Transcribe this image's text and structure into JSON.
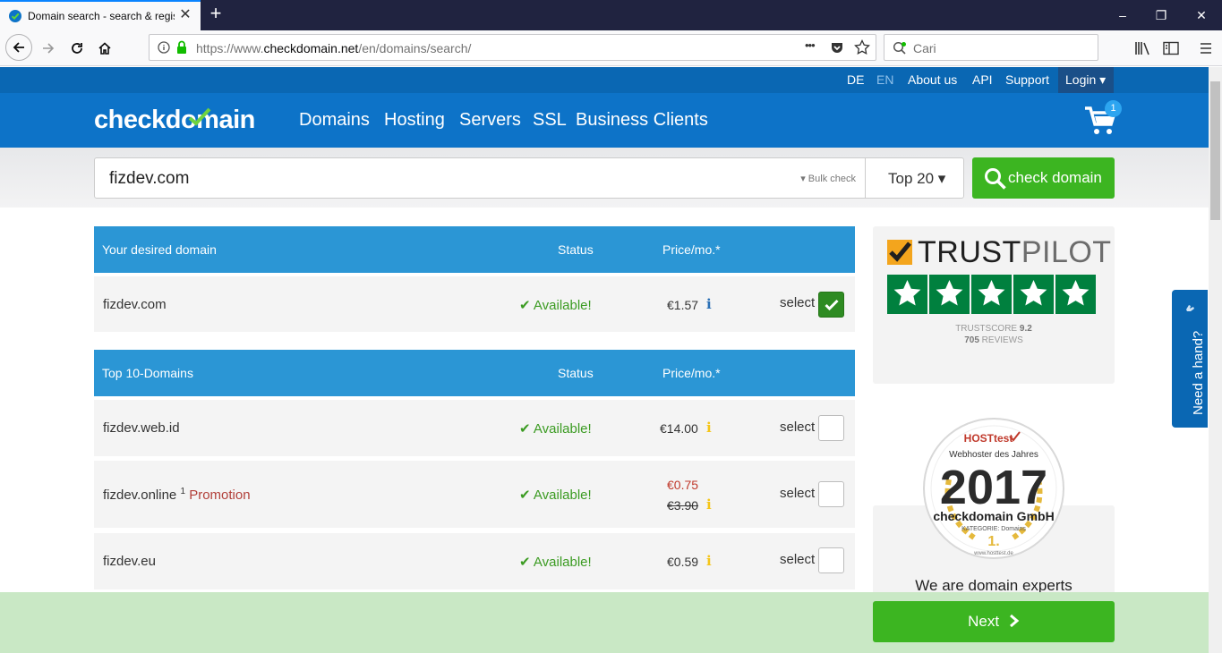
{
  "browser": {
    "tab_title": "Domain search - search & regis",
    "url_prefix": "https://www.",
    "url_domain": "checkdomain.net",
    "url_path": "/en/domains/search/",
    "search_placeholder": "Cari",
    "minimize": "–",
    "restore": "❐",
    "close": "✕",
    "new_tab": "+",
    "tab_close": "✕",
    "page_actions": "•••"
  },
  "topnav": {
    "lang_de": "DE",
    "lang_en": "EN",
    "about": "About us",
    "api": "API",
    "support": "Support",
    "login": "Login ▾"
  },
  "header": {
    "logo": "checkdomain",
    "nav": [
      "Domains",
      "Hosting",
      "Servers",
      "SSL",
      "Business Clients"
    ],
    "cart_count": "1"
  },
  "search": {
    "value": "fizdev.com",
    "bulk": "▾ Bulk check",
    "top": "Top 20 ▾",
    "button": "check domain"
  },
  "desired": {
    "header": "Your desired domain",
    "status_header": "Status",
    "price_header": "Price/mo.*",
    "rows": [
      {
        "domain": "fizdev.com",
        "status": "✔ Available!",
        "price": "€1.57",
        "select": "select",
        "checked": true
      }
    ]
  },
  "top10": {
    "header": "Top 10-Domains",
    "status_header": "Status",
    "price_header": "Price/mo.*",
    "rows": [
      {
        "domain": "fizdev.web.id",
        "status": "✔ Available!",
        "price": "€14.00",
        "select": "select"
      },
      {
        "domain": "fizdev.online",
        "sup": "1",
        "promo": "Promotion",
        "status": "✔ Available!",
        "price_new": "€0.75",
        "price_old": "€3.90",
        "select": "select"
      },
      {
        "domain": "fizdev.eu",
        "status": "✔ Available!",
        "price": "€0.59",
        "select": "select"
      }
    ]
  },
  "trustpilot": {
    "logo_a": "TRUST",
    "logo_b": "PILOT",
    "score_label": "TRUSTSCORE",
    "score": "9.2",
    "reviews_count": "705",
    "reviews_label": "REVIEWS"
  },
  "award": {
    "brand": "HOSTtest",
    "line1": "Webhoster des Jahres",
    "year": "2017",
    "company": "checkdomain GmbH",
    "category": "KATEGORIE: Domains",
    "rank": "1.",
    "site": "www.hosttest.de",
    "experts": "We are domain experts"
  },
  "help": {
    "label": "Need a hand?"
  },
  "footer": {
    "next": "Next"
  },
  "colors": {
    "primary_blue": "#0d73c8",
    "green": "#3cb521",
    "available": "#3b9b22",
    "trust_green": "#00803e"
  }
}
